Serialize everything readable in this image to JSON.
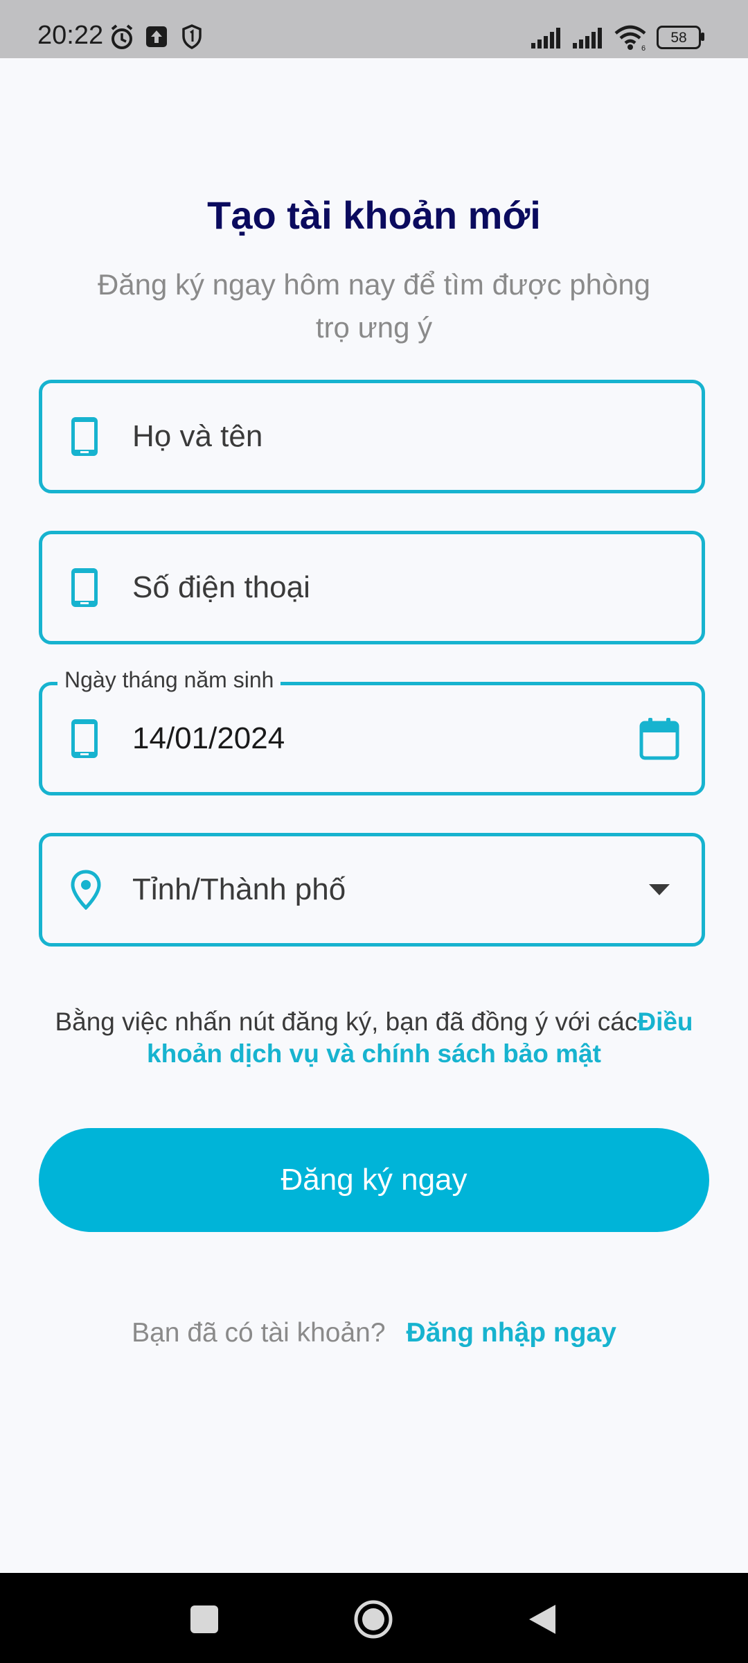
{
  "status_bar": {
    "time": "20:22",
    "battery": "58",
    "icons": [
      "alarm-icon",
      "upload-icon",
      "shield-icon",
      "signal-icon",
      "signal-icon",
      "wifi-icon",
      "battery-icon"
    ]
  },
  "header": {
    "title": "Tạo tài khoản mới",
    "subtitle": "Đăng ký ngay hôm nay để tìm được phòng trọ ưng ý"
  },
  "form": {
    "name_placeholder": "Họ và tên",
    "phone_placeholder": "Số điện thoại",
    "dob_label": "Ngày tháng năm sinh",
    "dob_value": "14/01/2024",
    "province_placeholder": "Tỉnh/Thành phố"
  },
  "terms": {
    "text": "Bằng việc nhấn nút đăng ký, bạn đã đồng ý với các",
    "link": "Điều khoản dịch vụ và chính sách bảo mật"
  },
  "register_button": "Đăng ký ngay",
  "login": {
    "prompt": "Bạn đã có tài khoản?",
    "link": "Đăng nhập ngay"
  },
  "colors": {
    "accent": "#17b3cf",
    "button": "#00b4d8",
    "title": "#0b0b5e"
  }
}
